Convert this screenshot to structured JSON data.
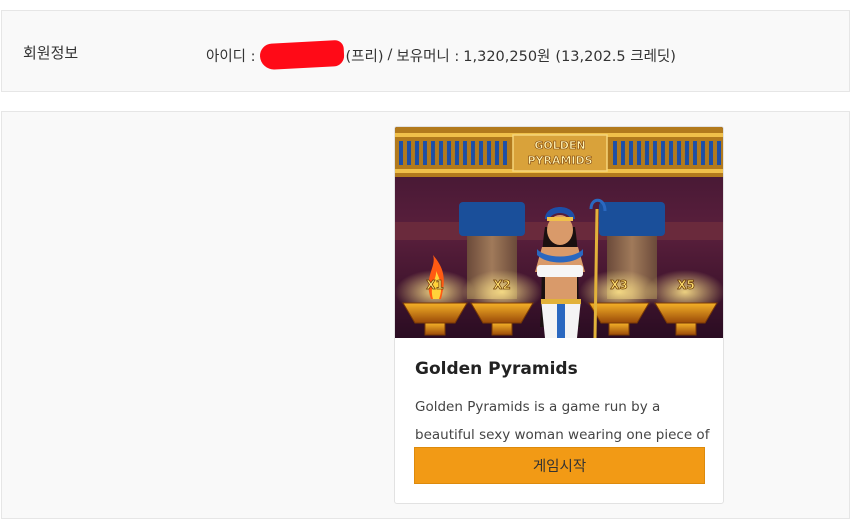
{
  "member": {
    "label": "회원정보",
    "id_label": "아이디 :",
    "account_type": "(프리)",
    "separator": "/",
    "balance_label": "보유머니 :",
    "balance": "1,320,250원",
    "credits": "(13,202.5 크레딧)"
  },
  "game": {
    "thumbnail_logo_line1": "GOLDEN",
    "thumbnail_logo_line2": "PYRAMIDS",
    "multipliers": [
      "X1",
      "X2",
      "X3",
      "X5"
    ],
    "title": "Golden Pyramids",
    "description": "Golden Pyramids is a game run by a beautiful sexy woman wearing one piece of sarong.",
    "start_label": "게임시작"
  },
  "colors": {
    "start_button": "#f29a15",
    "redaction": "#ff0a17",
    "panel_bg": "#f9f9f9"
  }
}
